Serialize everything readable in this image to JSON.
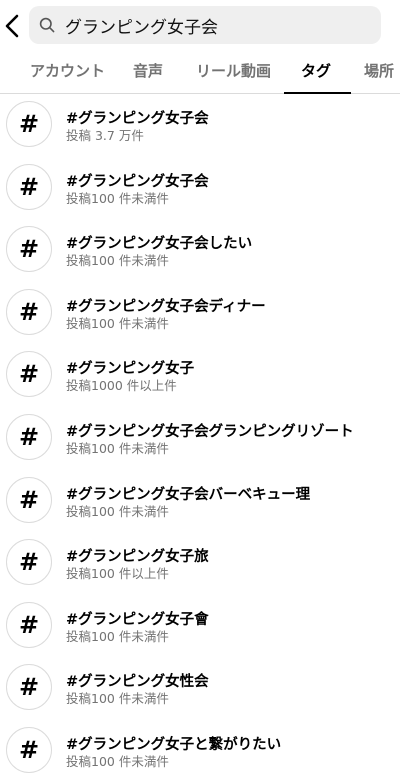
{
  "search": {
    "query": "グランピング女子会"
  },
  "tabs": [
    {
      "label": "アカウント"
    },
    {
      "label": "音声"
    },
    {
      "label": "リール動画"
    },
    {
      "label": "タグ"
    },
    {
      "label": "場所"
    }
  ],
  "active_tab": "タグ",
  "results": [
    {
      "icon": "#",
      "title": "#グランピング女子会",
      "subtitle": "投稿 3.7 万件"
    },
    {
      "icon": "#",
      "title": "#グランピング女子会",
      "subtitle": "投稿100 件未満件"
    },
    {
      "icon": "#",
      "title": "#グランピング女子会したい",
      "subtitle": "投稿100 件未満件"
    },
    {
      "icon": "#",
      "title": "#グランピング女子会ディナー",
      "subtitle": "投稿100 件未満件"
    },
    {
      "icon": "#",
      "title": "#グランピング女子",
      "subtitle": "投稿1000 件以上件"
    },
    {
      "icon": "#",
      "title": "#グランピング女子会グランピングリゾート",
      "subtitle": "投稿100 件未満件"
    },
    {
      "icon": "#",
      "title": "#グランピング女子会バーベキュー理",
      "subtitle": "投稿100 件未満件"
    },
    {
      "icon": "#",
      "title": "#グランピング女子旅",
      "subtitle": "投稿100 件以上件"
    },
    {
      "icon": "#",
      "title": "#グランピング女子會",
      "subtitle": "投稿100 件未満件"
    },
    {
      "icon": "#",
      "title": "#グランピング女性会",
      "subtitle": "投稿100 件未満件"
    },
    {
      "icon": "#",
      "title": "#グランピング女子と繋がりたい",
      "subtitle": "投稿100 件未満件"
    }
  ],
  "icons": {
    "back": "chevron-left-icon",
    "search": "search-icon",
    "result": "hashtag-icon"
  },
  "colors": {
    "search_bg": "#efefef",
    "secondary_text": "#737373",
    "divider": "#dbdbdb"
  }
}
